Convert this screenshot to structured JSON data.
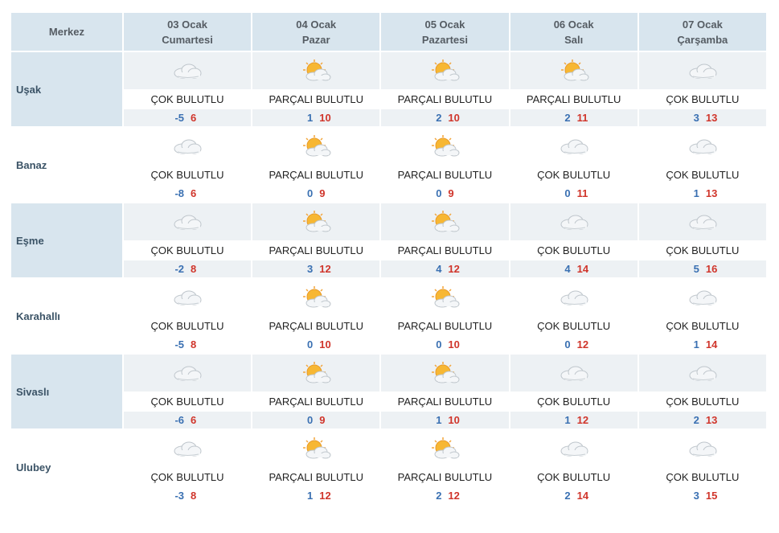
{
  "header": {
    "corner": "Merkez",
    "days": [
      {
        "date": "03 Ocak",
        "weekday": "Cumartesi"
      },
      {
        "date": "04 Ocak",
        "weekday": "Pazar"
      },
      {
        "date": "05 Ocak",
        "weekday": "Pazartesi"
      },
      {
        "date": "06 Ocak",
        "weekday": "Salı"
      },
      {
        "date": "07 Ocak",
        "weekday": "Çarşamba"
      }
    ]
  },
  "colors": {
    "min": "#3a70b2",
    "max": "#d0352b",
    "header_bg": "#d8e5ee"
  },
  "rows": [
    {
      "city": "Uşak",
      "shaded": true,
      "days": [
        {
          "icon": "cloudy-icon",
          "desc": "ÇOK BULUTLU",
          "min": "-5",
          "max": "6"
        },
        {
          "icon": "partly-cloudy-icon",
          "desc": "PARÇALI BULUTLU",
          "min": "1",
          "max": "10"
        },
        {
          "icon": "partly-cloudy-icon",
          "desc": "PARÇALI BULUTLU",
          "min": "2",
          "max": "10"
        },
        {
          "icon": "partly-cloudy-icon",
          "desc": "PARÇALI BULUTLU",
          "min": "2",
          "max": "11"
        },
        {
          "icon": "cloudy-icon",
          "desc": "ÇOK BULUTLU",
          "min": "3",
          "max": "13"
        }
      ]
    },
    {
      "city": "Banaz",
      "shaded": false,
      "days": [
        {
          "icon": "cloudy-icon",
          "desc": "ÇOK BULUTLU",
          "min": "-8",
          "max": "6"
        },
        {
          "icon": "partly-cloudy-icon",
          "desc": "PARÇALI BULUTLU",
          "min": "0",
          "max": "9"
        },
        {
          "icon": "partly-cloudy-icon",
          "desc": "PARÇALI BULUTLU",
          "min": "0",
          "max": "9"
        },
        {
          "icon": "cloudy-icon",
          "desc": "ÇOK BULUTLU",
          "min": "0",
          "max": "11"
        },
        {
          "icon": "cloudy-icon",
          "desc": "ÇOK BULUTLU",
          "min": "1",
          "max": "13"
        }
      ]
    },
    {
      "city": "Eşme",
      "shaded": true,
      "days": [
        {
          "icon": "cloudy-icon",
          "desc": "ÇOK BULUTLU",
          "min": "-2",
          "max": "8"
        },
        {
          "icon": "partly-cloudy-icon",
          "desc": "PARÇALI BULUTLU",
          "min": "3",
          "max": "12"
        },
        {
          "icon": "partly-cloudy-icon",
          "desc": "PARÇALI BULUTLU",
          "min": "4",
          "max": "12"
        },
        {
          "icon": "cloudy-icon",
          "desc": "ÇOK BULUTLU",
          "min": "4",
          "max": "14"
        },
        {
          "icon": "cloudy-icon",
          "desc": "ÇOK BULUTLU",
          "min": "5",
          "max": "16"
        }
      ]
    },
    {
      "city": "Karahallı",
      "shaded": false,
      "days": [
        {
          "icon": "cloudy-icon",
          "desc": "ÇOK BULUTLU",
          "min": "-5",
          "max": "8"
        },
        {
          "icon": "partly-cloudy-icon",
          "desc": "PARÇALI BULUTLU",
          "min": "0",
          "max": "10"
        },
        {
          "icon": "partly-cloudy-icon",
          "desc": "PARÇALI BULUTLU",
          "min": "0",
          "max": "10"
        },
        {
          "icon": "cloudy-icon",
          "desc": "ÇOK BULUTLU",
          "min": "0",
          "max": "12"
        },
        {
          "icon": "cloudy-icon",
          "desc": "ÇOK BULUTLU",
          "min": "1",
          "max": "14"
        }
      ]
    },
    {
      "city": "Sivaslı",
      "shaded": true,
      "days": [
        {
          "icon": "cloudy-icon",
          "desc": "ÇOK BULUTLU",
          "min": "-6",
          "max": "6"
        },
        {
          "icon": "partly-cloudy-icon",
          "desc": "PARÇALI BULUTLU",
          "min": "0",
          "max": "9"
        },
        {
          "icon": "partly-cloudy-icon",
          "desc": "PARÇALI BULUTLU",
          "min": "1",
          "max": "10"
        },
        {
          "icon": "cloudy-icon",
          "desc": "ÇOK BULUTLU",
          "min": "1",
          "max": "12"
        },
        {
          "icon": "cloudy-icon",
          "desc": "ÇOK BULUTLU",
          "min": "2",
          "max": "13"
        }
      ]
    },
    {
      "city": "Ulubey",
      "shaded": false,
      "days": [
        {
          "icon": "cloudy-icon",
          "desc": "ÇOK BULUTLU",
          "min": "-3",
          "max": "8"
        },
        {
          "icon": "partly-cloudy-icon",
          "desc": "PARÇALI BULUTLU",
          "min": "1",
          "max": "12"
        },
        {
          "icon": "partly-cloudy-icon",
          "desc": "PARÇALI BULUTLU",
          "min": "2",
          "max": "12"
        },
        {
          "icon": "cloudy-icon",
          "desc": "ÇOK BULUTLU",
          "min": "2",
          "max": "14"
        },
        {
          "icon": "cloudy-icon",
          "desc": "ÇOK BULUTLU",
          "min": "3",
          "max": "15"
        }
      ]
    }
  ]
}
